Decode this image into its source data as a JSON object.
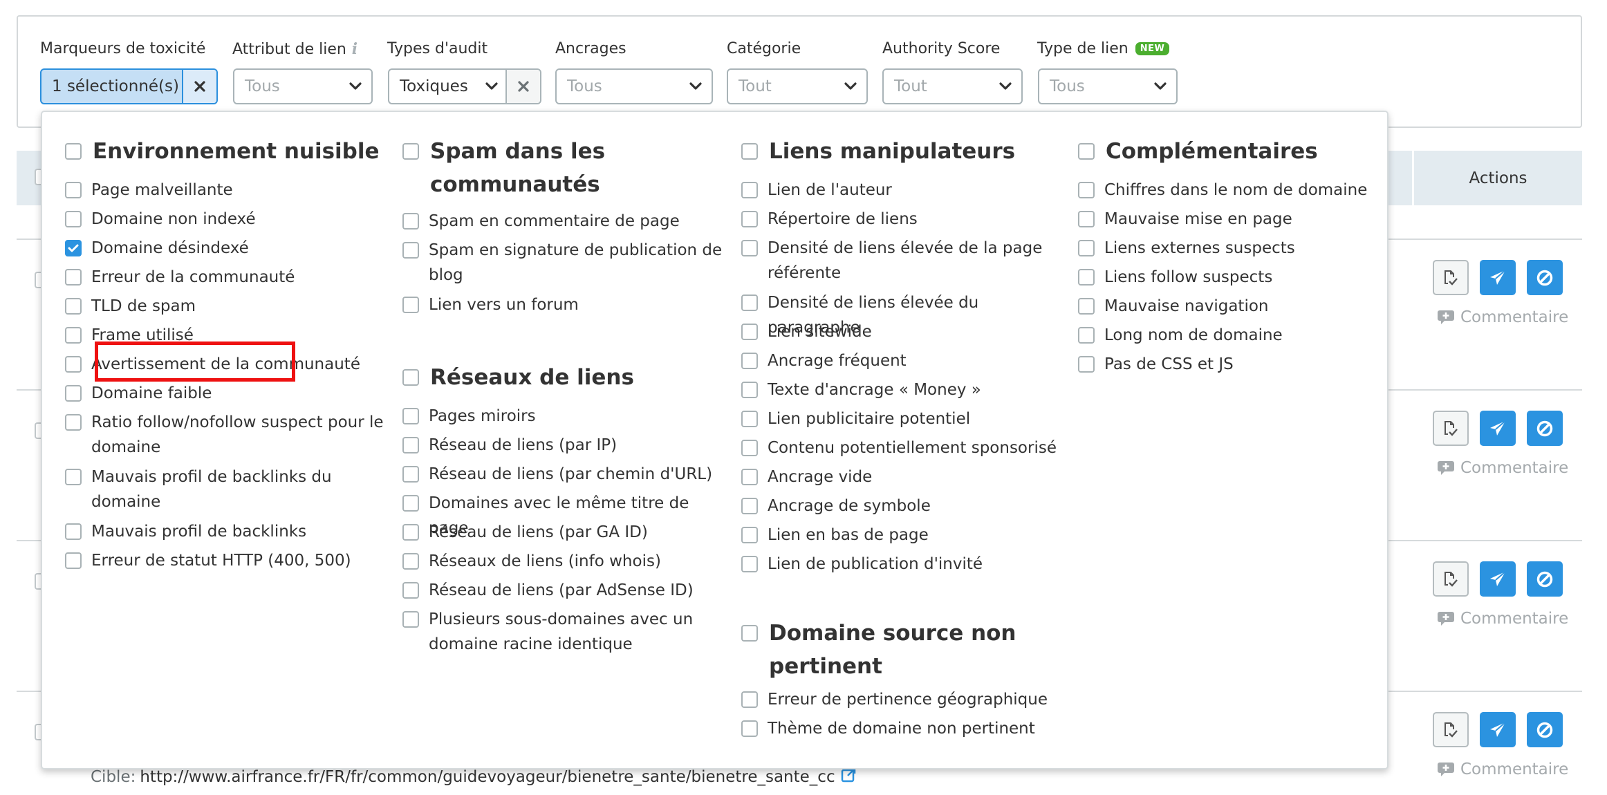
{
  "filters": {
    "toxicity": {
      "label": "Marqueurs de toxicité",
      "value": "1 sélectionné(s)"
    },
    "link_attribute": {
      "label": "Attribut de lien",
      "placeholder": "Tous"
    },
    "audit_types": {
      "label": "Types d'audit",
      "value": "Toxiques"
    },
    "anchors": {
      "label": "Ancrages",
      "placeholder": "Tous"
    },
    "category": {
      "label": "Catégorie",
      "placeholder": "Tout"
    },
    "authority_score": {
      "label": "Authority Score",
      "placeholder": "Tout"
    },
    "link_type": {
      "label": "Type de lien",
      "badge": "NEW",
      "placeholder": "Tous"
    }
  },
  "colors": {
    "accent": "#2b93e0",
    "selected_bg": "#c5dff5",
    "new_badge": "#4bae2f",
    "highlight": "#ee1111"
  },
  "table": {
    "actions_header": "Actions",
    "comment_label": "Commentaire",
    "target_label": "Cible:",
    "target_url": "http://www.airfrance.fr/FR/fr/common/guidevoyageur/bienetre_sante/bienetre_sante_cc",
    "rows": [
      {
        "actions": [
          "review-icon",
          "send-icon",
          "disavow-icon"
        ]
      },
      {
        "actions": [
          "review-icon",
          "send-icon",
          "disavow-icon"
        ]
      },
      {
        "actions": [
          "review-icon",
          "send-icon",
          "disavow-icon"
        ]
      },
      {
        "actions": [
          "review-icon",
          "send-icon",
          "disavow-icon"
        ]
      }
    ]
  },
  "popup": {
    "groups": [
      {
        "title": "Environnement nuisible",
        "checked": false,
        "items": [
          {
            "label": "Page malveillante",
            "checked": false
          },
          {
            "label": "Domaine non indexé",
            "checked": false
          },
          {
            "label": "Domaine désindexé",
            "checked": true
          },
          {
            "label": "Erreur de la communauté",
            "checked": false
          },
          {
            "label": "TLD de spam",
            "checked": false
          },
          {
            "label": "Frame utilisé",
            "checked": false
          },
          {
            "label": "Avertissement de la communauté",
            "checked": false
          },
          {
            "label": "Domaine faible",
            "checked": false
          },
          {
            "label": "Ratio follow/nofollow suspect pour le domaine",
            "checked": false
          },
          {
            "label": "Mauvais profil de backlinks du domaine",
            "checked": false
          },
          {
            "label": "Mauvais profil de backlinks",
            "checked": false
          },
          {
            "label": "Erreur de statut HTTP (400, 500)",
            "checked": false
          }
        ]
      },
      {
        "title": "Spam dans les communautés",
        "checked": false,
        "items": [
          {
            "label": "Spam en commentaire de page",
            "checked": false
          },
          {
            "label": "Spam en signature de publication de blog",
            "checked": false
          },
          {
            "label": "Lien vers un forum",
            "checked": false
          }
        ]
      },
      {
        "title": "Réseaux de liens",
        "checked": false,
        "items": [
          {
            "label": "Pages miroirs",
            "checked": false
          },
          {
            "label": "Réseau de liens (par IP)",
            "checked": false
          },
          {
            "label": "Réseau de liens (par chemin d'URL)",
            "checked": false
          },
          {
            "label": "Domaines avec le même titre de page",
            "checked": false
          },
          {
            "label": "Réseau de liens (par GA ID)",
            "checked": false
          },
          {
            "label": "Réseaux de liens (info whois)",
            "checked": false
          },
          {
            "label": "Réseau de liens (par AdSense ID)",
            "checked": false
          },
          {
            "label": "Plusieurs sous-domaines avec un domaine racine identique",
            "checked": false
          }
        ]
      },
      {
        "title": "Liens manipulateurs",
        "checked": false,
        "items": [
          {
            "label": "Lien de l'auteur",
            "checked": false
          },
          {
            "label": "Répertoire de liens",
            "checked": false
          },
          {
            "label": "Densité de liens élevée de la page référente",
            "checked": false
          },
          {
            "label": "Densité de liens élevée du paragraphe",
            "checked": false
          },
          {
            "label": "Lien sitewide",
            "checked": false
          },
          {
            "label": "Ancrage fréquent",
            "checked": false
          },
          {
            "label": "Texte d'ancrage « Money »",
            "checked": false
          },
          {
            "label": "Lien publicitaire potentiel",
            "checked": false
          },
          {
            "label": "Contenu potentiellement sponsorisé",
            "checked": false
          },
          {
            "label": "Ancrage vide",
            "checked": false
          },
          {
            "label": "Ancrage de symbole",
            "checked": false
          },
          {
            "label": "Lien en bas de page",
            "checked": false
          },
          {
            "label": "Lien de publication d'invité",
            "checked": false
          }
        ]
      },
      {
        "title": "Domaine source non pertinent",
        "checked": false,
        "items": [
          {
            "label": "Erreur de pertinence géographique",
            "checked": false
          },
          {
            "label": "Thème de domaine non pertinent",
            "checked": false
          }
        ]
      },
      {
        "title": "Complémentaires",
        "checked": false,
        "items": [
          {
            "label": "Chiffres dans le nom de domaine",
            "checked": false
          },
          {
            "label": "Mauvaise mise en page",
            "checked": false
          },
          {
            "label": "Liens externes suspects",
            "checked": false
          },
          {
            "label": "Liens follow suspects",
            "checked": false
          },
          {
            "label": "Mauvaise navigation",
            "checked": false
          },
          {
            "label": "Long nom de domaine",
            "checked": false
          },
          {
            "label": "Pas de CSS et JS",
            "checked": false
          }
        ]
      }
    ]
  }
}
